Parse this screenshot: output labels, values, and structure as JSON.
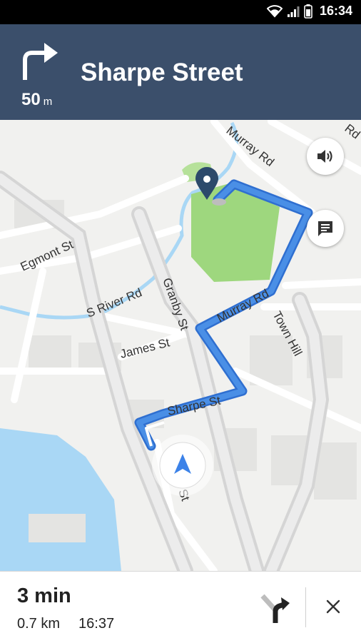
{
  "status_bar": {
    "time": "16:34",
    "icons": [
      "wifi-icon",
      "signal-icon",
      "battery-icon"
    ]
  },
  "navigation": {
    "maneuver_icon": "turn-right-icon",
    "distance_value": "50",
    "distance_unit": "m",
    "street_name": "Sharpe Street"
  },
  "map": {
    "street_labels": {
      "murray_rd_top": "Murray Rd",
      "rd_corner": "Rd",
      "egmont_st": "Egmont St",
      "s_river_rd": "S River Rd",
      "granby_st": "Granby St",
      "murray_rd": "Murray Rd",
      "town_hill": "Town Hill",
      "james_st": "James St",
      "sharpe_st": "Sharpe St",
      "bottom_st": "St"
    },
    "buttons": {
      "sound": "volume-icon",
      "report": "message-icon"
    },
    "colors": {
      "route": "#4a8fe6",
      "route_outline": "#2f6fd0",
      "park": "#9ed77e",
      "water": "#a9d7f5",
      "destination_pin": "#2c4a6b"
    }
  },
  "trip": {
    "remaining_time": "3 min",
    "remaining_distance": "0.7 km",
    "arrival_time": "16:37",
    "next_maneuver_icon": "turn-right-icon",
    "close_icon": "close-icon"
  }
}
